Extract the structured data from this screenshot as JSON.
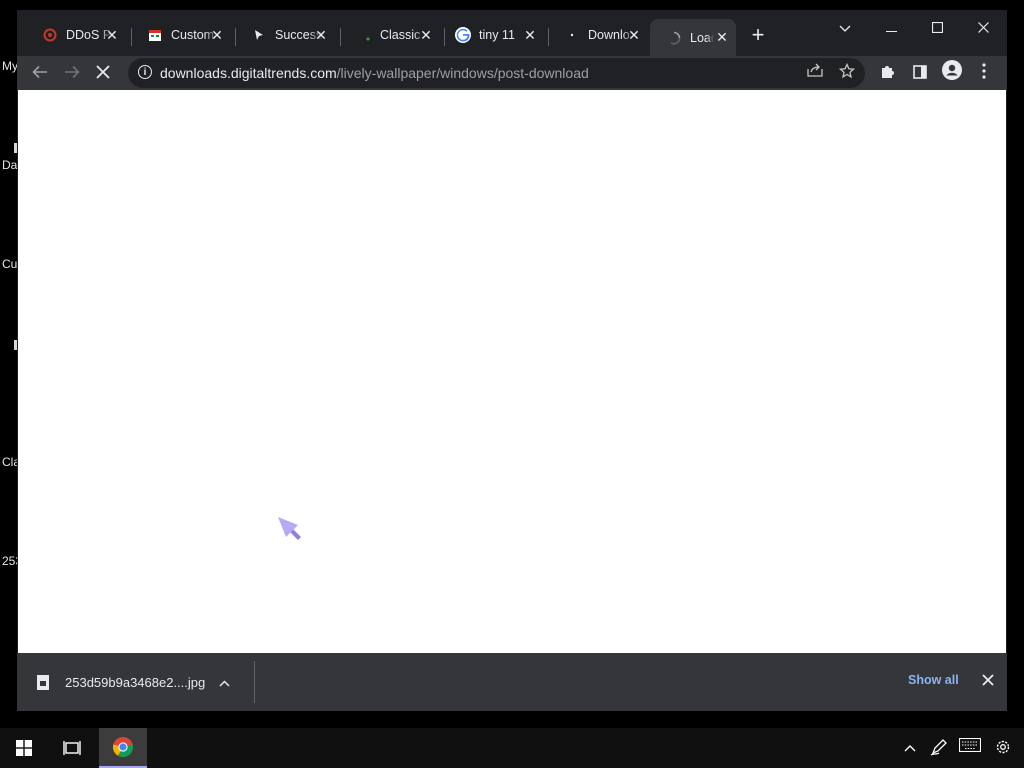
{
  "desktop": {
    "icons": [
      {
        "label": "My"
      },
      {
        "label": "Da"
      },
      {
        "label": "Cu"
      },
      {
        "label": "Cla"
      },
      {
        "label": "253"
      }
    ]
  },
  "browser": {
    "tabs": [
      {
        "title": "DDoS P",
        "icon": "ddos-favicon"
      },
      {
        "title": "Custom",
        "icon": "calendar-favicon"
      },
      {
        "title": "Success",
        "icon": "cursor-favicon"
      },
      {
        "title": "Classic",
        "icon": "classic-favicon"
      },
      {
        "title": "tiny 11",
        "icon": "google-favicon"
      },
      {
        "title": "Downlo",
        "icon": "dot-favicon"
      },
      {
        "title": "Load",
        "icon": "loading-spinner",
        "active": true
      }
    ],
    "url_host": "downloads.digitaltrends.com",
    "url_path": "/lively-wallpaper/windows/post-download",
    "download": {
      "filename": "253d59b9a3468e2....jpg",
      "show_all": "Show all"
    }
  }
}
